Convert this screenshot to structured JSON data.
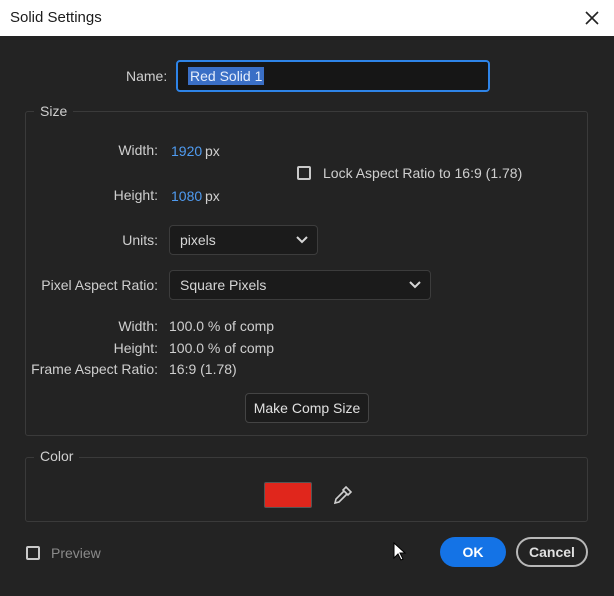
{
  "window": {
    "title": "Solid Settings"
  },
  "name": {
    "label": "Name:",
    "value": "Red Solid 1"
  },
  "size": {
    "group_title": "Size",
    "width_label": "Width:",
    "width_value": "1920",
    "width_unit": "px",
    "height_label": "Height:",
    "height_value": "1080",
    "height_unit": "px",
    "lock_aspect_label": "Lock Aspect Ratio to 16:9 (1.78)",
    "lock_aspect_checked": false,
    "units_label": "Units:",
    "units_value": "pixels",
    "par_label": "Pixel Aspect Ratio:",
    "par_value": "Square Pixels",
    "comp_width_label": "Width:",
    "comp_width_value": "100.0 % of comp",
    "comp_height_label": "Height:",
    "comp_height_value": "100.0 % of comp",
    "frame_aspect_label": "Frame Aspect Ratio:",
    "frame_aspect_value": "16:9 (1.78)",
    "make_comp_size_label": "Make Comp Size"
  },
  "color": {
    "group_title": "Color",
    "swatch_color": "#e0261c",
    "eyedropper_icon": "eyedropper-icon"
  },
  "footer": {
    "preview_label": "Preview",
    "preview_checked": false,
    "ok_label": "OK",
    "cancel_label": "Cancel"
  },
  "colors": {
    "accent": "#1473e6",
    "value_blue": "#4f9bf0",
    "background": "#232323"
  }
}
